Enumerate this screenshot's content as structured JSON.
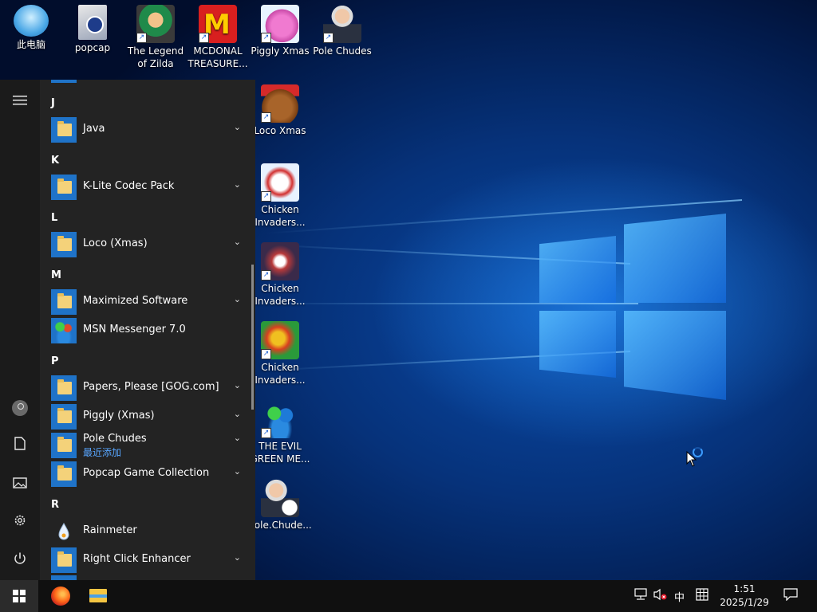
{
  "desktop_icons": [
    {
      "label": "此电脑",
      "icon": "computer-icon"
    },
    {
      "label": "popcap",
      "icon": "folder-icon"
    },
    {
      "label": "The Legend of Zilda",
      "icon": "game-zilda-icon"
    },
    {
      "label": "MCDONAL TREASURE...",
      "icon": "mcdonalds-icon"
    },
    {
      "label": "Piggly Xmas",
      "icon": "piggly-icon"
    },
    {
      "label": "Pole Chudes",
      "icon": "pole-chudes-icon"
    },
    {
      "label": "Loco Xmas",
      "icon": "loco-xmas-icon"
    },
    {
      "label": "Chicken Invaders...",
      "icon": "chicken-invaders-icon"
    },
    {
      "label": "Chicken Invaders...",
      "icon": "chicken-invaders-icon"
    },
    {
      "label": "Chicken Invaders...",
      "icon": "chicken-invaders-icon"
    },
    {
      "label": "THE EVIL GREEN ME...",
      "icon": "msn-icon"
    },
    {
      "label": "Pole.Chude...",
      "icon": "pole-chudes-setup-icon"
    }
  ],
  "start_menu": {
    "sections": {
      "j": "J",
      "k": "K",
      "l": "L",
      "m": "M",
      "p": "P",
      "r": "R"
    },
    "apps": {
      "java": "Java",
      "klite": "K-Lite Codec Pack",
      "loco": "Loco (Xmas)",
      "maximized": "Maximized Software",
      "msn": "MSN Messenger 7.0",
      "papers": "Papers, Please [GOG.com]",
      "piggly": "Piggly (Xmas)",
      "pole": "Pole Chudes",
      "pole_sub": "最近添加",
      "popcap": "Popcap Game Collection",
      "rainmeter": "Rainmeter",
      "rightclick": "Right Click Enhancer"
    }
  },
  "taskbar": {
    "ime": "中",
    "time": "1:51",
    "date": "2025/1/29"
  },
  "colors": {
    "accent": "#1f73c8",
    "recently_added": "#58a6ff",
    "taskbar": "#101010",
    "start_menu": "#232323"
  }
}
